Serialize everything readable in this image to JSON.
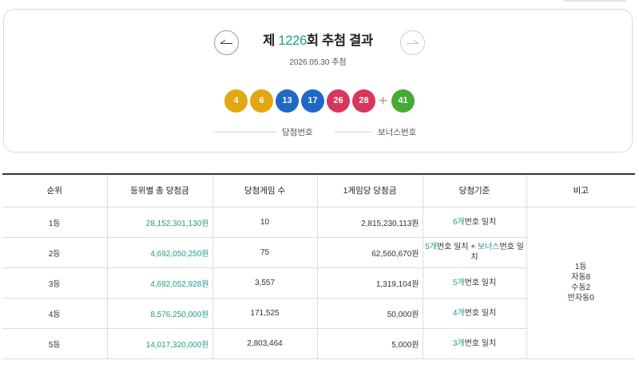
{
  "draw": {
    "prefix": "제 ",
    "round": "1226",
    "suffix": "회 추첨 결과",
    "date": "2026.05.30 추첨",
    "numbers": [
      {
        "value": "4",
        "color": "#e2a712"
      },
      {
        "value": "6",
        "color": "#e2a712"
      },
      {
        "value": "13",
        "color": "#1e68c8"
      },
      {
        "value": "17",
        "color": "#1e68c8"
      },
      {
        "value": "26",
        "color": "#d6375a"
      },
      {
        "value": "28",
        "color": "#d6375a"
      }
    ],
    "plus": "+",
    "bonus": {
      "value": "41",
      "color": "#46a934"
    },
    "main_label": "당첨번호",
    "bonus_label": "보너스번호"
  },
  "table": {
    "headers": [
      "순위",
      "등위별 총 당첨금",
      "당첨게임 수",
      "1게임당 당첨금",
      "당첨기준",
      "비고"
    ],
    "rows": [
      {
        "rank": "1등",
        "total": "28,152,301,130원",
        "games": "10",
        "per_game": "2,815,230,113원",
        "crit_count": "6개",
        "crit_text": "번호 일치"
      },
      {
        "rank": "2등",
        "total": "4,692,050,250원",
        "games": "75",
        "per_game": "62,560,670원",
        "crit_count": "5개",
        "crit_text": "번호 일치 + ",
        "crit_bonus": "보너스",
        "crit_tail": "번호 일치"
      },
      {
        "rank": "3등",
        "total": "4,692,052,928원",
        "games": "3,557",
        "per_game": "1,319,104원",
        "crit_count": "5개",
        "crit_text": "번호 일치"
      },
      {
        "rank": "4등",
        "total": "8,576,250,000원",
        "games": "171,525",
        "per_game": "50,000원",
        "crit_count": "4개",
        "crit_text": "번호 일치"
      },
      {
        "rank": "5등",
        "total": "14,017,320,000원",
        "games": "2,803,464",
        "per_game": "5,000원",
        "crit_count": "3개",
        "crit_text": "번호 일치"
      }
    ],
    "note": [
      "1등",
      "자동8",
      "수동2",
      "반자동0"
    ]
  },
  "colors": {
    "accent": "#1f9d8b"
  }
}
